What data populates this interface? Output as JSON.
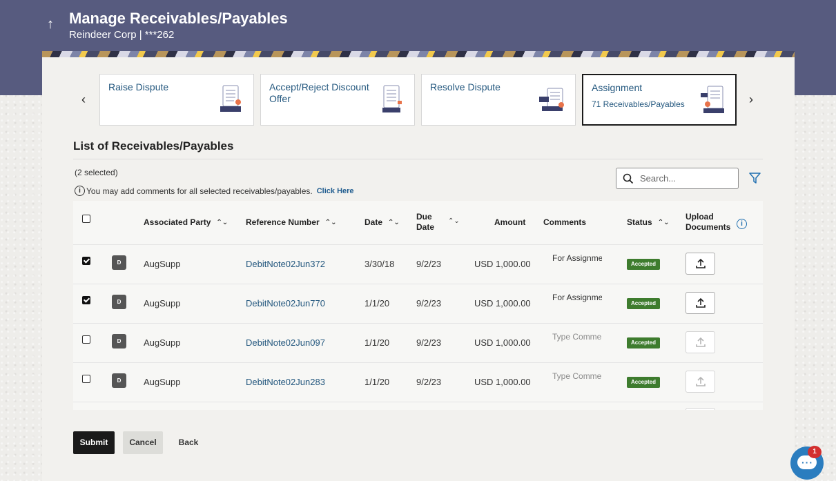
{
  "header": {
    "title": "Manage Receivables/Payables",
    "subtitle": "Reindeer Corp | ***262"
  },
  "cards": [
    {
      "title": "Raise Dispute",
      "sub": "",
      "icon": "document-edit-icon",
      "active": false
    },
    {
      "title": "Accept/Reject Discount Offer",
      "sub": "",
      "icon": "document-list-icon",
      "active": false
    },
    {
      "title": "Resolve Dispute",
      "sub": "",
      "icon": "document-resolve-icon",
      "active": false
    },
    {
      "title": "Assignment",
      "sub": "71 Receivables/Payables",
      "icon": "document-assign-icon",
      "active": true
    }
  ],
  "list": {
    "title": "List of Receivables/Payables",
    "selected": "(2 selected)",
    "hint": "You may add comments for all selected receivables/payables.",
    "hint_link": "Click Here",
    "search_placeholder": "Search..."
  },
  "table": {
    "headers": {
      "party": "Associated Party",
      "ref": "Reference Number",
      "date": "Date",
      "due": "Due Date",
      "amount": "Amount",
      "comments": "Comments",
      "status": "Status",
      "upload": "Upload Documents"
    },
    "rows": [
      {
        "checked": true,
        "avatar": "D",
        "party": "AugSupp",
        "ref": "DebitNote02Jun372",
        "date": "3/30/18",
        "due": "9/2/23",
        "amount": "USD 1,000.00",
        "comment": "For Assignme",
        "comment_ph": false,
        "status": "Accepted",
        "upload_enabled": true
      },
      {
        "checked": true,
        "avatar": "D",
        "party": "AugSupp",
        "ref": "DebitNote02Jun770",
        "date": "1/1/20",
        "due": "9/2/23",
        "amount": "USD 1,000.00",
        "comment": "For Assignme",
        "comment_ph": false,
        "status": "Accepted",
        "upload_enabled": true
      },
      {
        "checked": false,
        "avatar": "D",
        "party": "AugSupp",
        "ref": "DebitNote02Jun097",
        "date": "1/1/20",
        "due": "9/2/23",
        "amount": "USD 1,000.00",
        "comment": "Type Comme",
        "comment_ph": true,
        "status": "Accepted",
        "upload_enabled": false
      },
      {
        "checked": false,
        "avatar": "D",
        "party": "AugSupp",
        "ref": "DebitNote02Jun283",
        "date": "1/1/20",
        "due": "9/2/23",
        "amount": "USD 1,000.00",
        "comment": "Type Comme",
        "comment_ph": true,
        "status": "Accepted",
        "upload_enabled": false
      }
    ]
  },
  "buttons": {
    "submit": "Submit",
    "cancel": "Cancel",
    "back": "Back"
  },
  "chat": {
    "badge": "1"
  },
  "colors": {
    "header_bg": "#575b7f",
    "link": "#23577e",
    "status_accepted": "#3e7c2e",
    "primary_button": "#1a1a1a",
    "chat": "#2b7dbf"
  }
}
